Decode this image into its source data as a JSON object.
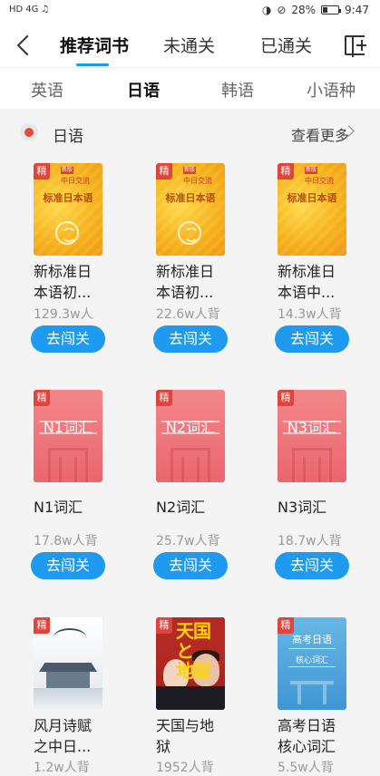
{
  "status": {
    "signal": "HD",
    "net": "4G",
    "battery": "28%",
    "time": "9:47"
  },
  "top_tabs": [
    "推荐词书",
    "未通关",
    "已通关"
  ],
  "lang_tabs": [
    "英语",
    "日语",
    "韩语",
    "小语种"
  ],
  "section": {
    "title": "日语",
    "more": "查看更多"
  },
  "go_label": "去闯关",
  "badge": "精",
  "books": [
    {
      "title1": "新标准日",
      "title2": "本语初...",
      "count": "129.3w人",
      "cover": {
        "pub": "中日交流",
        "mark": "新版",
        "line": "标准日本语"
      }
    },
    {
      "title1": "新标准日",
      "title2": "本语初...",
      "count": "22.6w人背",
      "cover": {
        "pub": "中日交流",
        "mark": "新版",
        "line": "标准日本语"
      }
    },
    {
      "title1": "新标准日",
      "title2": "本语中...",
      "count": "14.3w人背",
      "cover": {
        "pub": "中日交流",
        "mark": "新版",
        "line": "标准日本语"
      }
    },
    {
      "title1": "N1词汇",
      "title2": "",
      "count": "17.8w人背",
      "cover": {
        "text": "N1词汇"
      }
    },
    {
      "title1": "N2词汇",
      "title2": "",
      "count": "25.7w人背",
      "cover": {
        "text": "N2词汇"
      }
    },
    {
      "title1": "N3词汇",
      "title2": "",
      "count": "18.7w人背",
      "cover": {
        "text": "N3词汇"
      }
    },
    {
      "title1": "风月诗赋",
      "title2": "之中日...",
      "count": "1.2w人背",
      "cover": {}
    },
    {
      "title1": "天国与地",
      "title2": "狱",
      "count": "1952人背",
      "cover": {
        "line1": "天国と",
        "line2": "地獄"
      }
    },
    {
      "title1": "高考日语",
      "title2": "核心词汇",
      "count": "5.5w人背",
      "cover": {
        "line1": "高考日语",
        "line2": "核心词汇"
      }
    }
  ]
}
